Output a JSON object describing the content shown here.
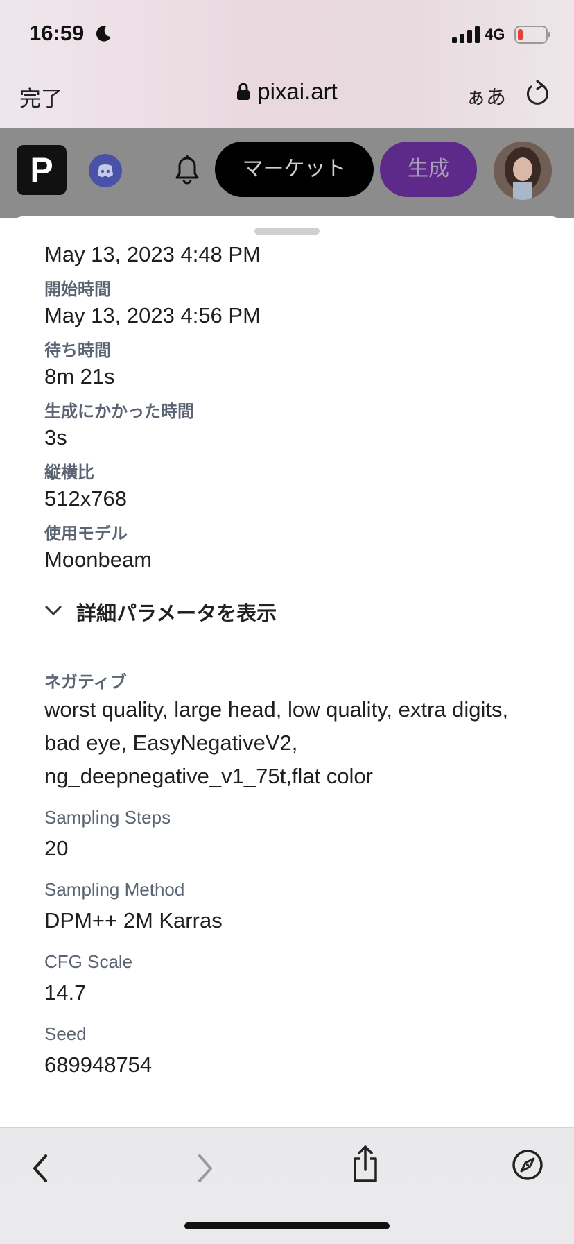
{
  "status_bar": {
    "time": "16:59",
    "network": "4G"
  },
  "safari": {
    "done_label": "完了",
    "address": "pixai.art",
    "aa_label": "ぁあ"
  },
  "site_header": {
    "logo_letter": "P",
    "market_label": "マーケット",
    "generate_label": "生成"
  },
  "details": {
    "created_value": "May 13, 2023 4:48 PM",
    "start_label": "開始時間",
    "start_value": "May 13, 2023 4:56 PM",
    "wait_label": "待ち時間",
    "wait_value": "8m 21s",
    "gen_time_label": "生成にかかった時間",
    "gen_time_value": "3s",
    "aspect_label": "縦横比",
    "aspect_value": "512x768",
    "model_label": "使用モデル",
    "model_value": "Moonbeam"
  },
  "advanced": {
    "toggle_label": "詳細パラメータを表示",
    "negative_label": "ネガティブ",
    "negative_lines": [
      "worst quality, large head, low quality, extra digits,",
      "bad eye, EasyNegativeV2,",
      "ng_deepnegative_v1_75t,flat color"
    ],
    "steps_label": "Sampling Steps",
    "steps_value": "20",
    "method_label": "Sampling Method",
    "method_value": "DPM++ 2M Karras",
    "cfg_label": "CFG Scale",
    "cfg_value": "14.7",
    "seed_label": "Seed",
    "seed_value": "689948754"
  },
  "colors": {
    "generate_purple": "#5d2a8a",
    "label_gray": "#5a6473",
    "battery_low": "#e5413b"
  },
  "icons": [
    "moon-icon",
    "signal-icon",
    "battery-icon",
    "lock-icon",
    "reload-icon",
    "discord-icon",
    "bell-icon",
    "chevron-down-icon",
    "back-arrow-icon",
    "forward-arrow-icon",
    "share-icon",
    "compass-icon"
  ]
}
